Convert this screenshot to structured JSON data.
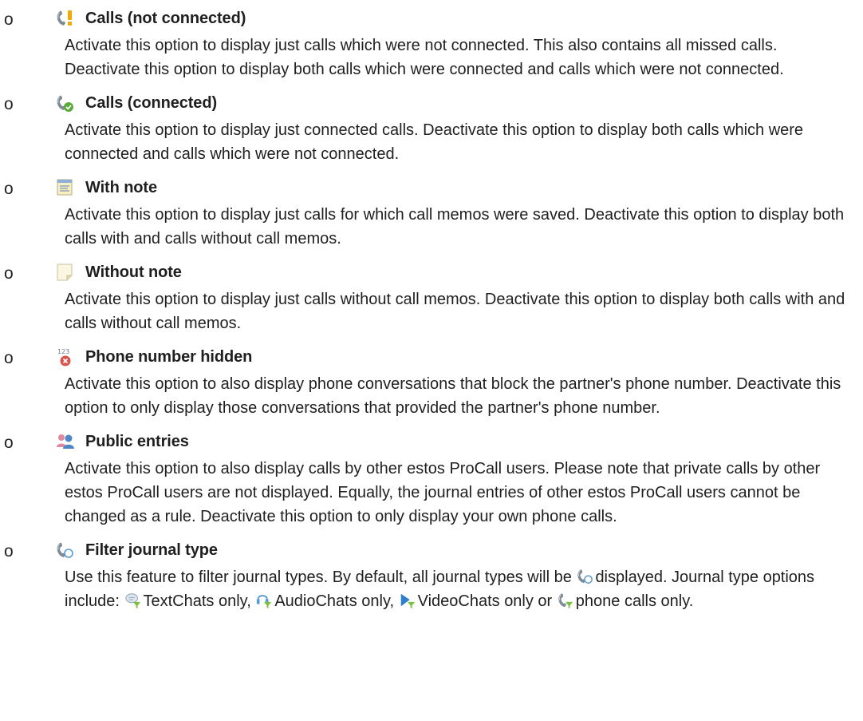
{
  "items": [
    {
      "icon": "phone-warning-icon",
      "title": "Calls (not connected)",
      "desc": "Activate this option to display just calls which were not connected. This also contains all missed calls. Deactivate this option to display both calls which were connected and calls which were not connected."
    },
    {
      "icon": "phone-connected-icon",
      "title": "Calls (connected)",
      "desc": "Activate this option to display just connected calls. Deactivate this option to display both calls which were connected and calls which were not connected."
    },
    {
      "icon": "note-icon",
      "title": "With note",
      "desc": "Activate this option to display just calls for which call memos were saved. Deactivate this option to display both calls with and calls without call memos."
    },
    {
      "icon": "blank-note-icon",
      "title": "Without note",
      "desc": "Activate this option to display just calls without call memos. Deactivate this option to display both calls with and calls without call memos."
    },
    {
      "icon": "hidden-number-icon",
      "title": "Phone number hidden",
      "desc": "Activate this option to also display phone conversations that block the partner's phone number. Deactivate this option to only display those conversations that provided the partner's phone number."
    },
    {
      "icon": "public-users-icon",
      "title": "Public entries",
      "desc": "Activate this option to also display calls by other estos ProCall users. Please note that private calls by other estos ProCall users are not displayed. Equally, the journal entries of other estos ProCall users cannot be changed as a rule. Deactivate this option to only display your own phone calls."
    },
    {
      "icon": "phone-filter-icon",
      "title": "Filter journal type",
      "desc_parts": {
        "p1": "Use this feature to filter journal types. By default, all journal types will be ",
        "p2": "displayed. Journal type options include: ",
        "p3": "TextChats only, ",
        "p4": "AudioChats only, ",
        "p5": "VideoChats only or ",
        "p6": "phone calls only."
      }
    }
  ],
  "bullet_char": "o"
}
